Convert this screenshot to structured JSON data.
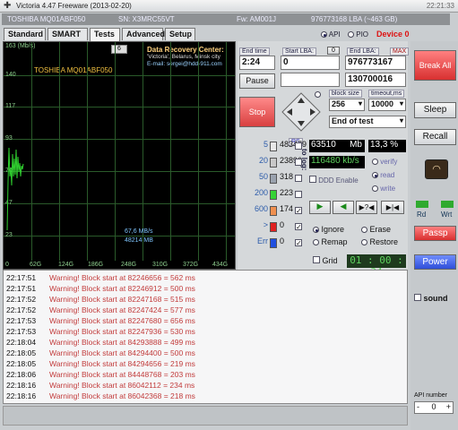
{
  "window": {
    "title": "Victoria 4.47  Freeware (2013-02-20)",
    "clock": "22:21:33"
  },
  "info": {
    "model": "TOSHIBA MQ01ABF050",
    "serial": "SN: X3MRC55VT",
    "firmware": "Fw: AM001J",
    "lba": "976773168 LBA (~463 GB)"
  },
  "tabs": [
    "Standard",
    "SMART",
    "Tests",
    "Advanced",
    "Setup"
  ],
  "api_mode": {
    "api_label": "API",
    "pio_label": "PIO",
    "selected": "API",
    "device": "Device 0"
  },
  "graph": {
    "unit": "163 (Mb/s)",
    "y_ticks": [
      "140",
      "117",
      "93",
      "70",
      "47",
      "23"
    ],
    "x_ticks": [
      "0",
      "62G",
      "124G",
      "186G",
      "248G",
      "310G",
      "372G",
      "434G"
    ],
    "model": "TOSHIBA MQ01ABF050",
    "step_value": "6",
    "speed": "67,6 MB/s",
    "processed": "48214 MB",
    "center_title": "Data Recovery Center:",
    "center_city": "'Victoria', Belarus, Minsk city",
    "center_email": "E-mail: sergei@hdd-911.com"
  },
  "controls": {
    "end_time_label": "End time",
    "end_time": "2:24",
    "start_lba_label": "Start LBA:",
    "start_lba": "0",
    "start_lba_btn": "0",
    "end_lba_label": "End LBA:",
    "end_lba_max": "MAX",
    "end_lba": "976773167",
    "cur_lba": "130700016",
    "pause_btn": "Pause",
    "stop_btn": "Stop",
    "block_size_label": "block size",
    "block_size": "256",
    "timeout_label": "timeout,ms",
    "timeout": "10000",
    "end_mode": "End of test"
  },
  "blocks": [
    {
      "cnt": "5",
      "val": "483479",
      "color": "#e8e8e8",
      "checked": false
    },
    {
      "cnt": "20",
      "val": "23896",
      "color": "#c8c8c8",
      "checked": false
    },
    {
      "cnt": "50",
      "val": "318",
      "color": "#9aa2ae",
      "checked": false
    },
    {
      "cnt": "200",
      "val": "223",
      "color": "#36d236",
      "checked": false
    },
    {
      "cnt": "600",
      "val": "174",
      "color": "#f09050",
      "checked": true
    },
    {
      "cnt": ">",
      "val": "0",
      "color": "#e02020",
      "checked": true
    },
    {
      "cnt": "Err",
      "val": "0",
      "color": "#2050e0",
      "checked": true
    }
  ],
  "to_log": "to log:",
  "rs": "RS",
  "stats": {
    "mb_done": "63510",
    "mb_unit": "Mb",
    "percent": "13,3",
    "pct_unit": "%",
    "speed": "116480",
    "speed_unit": "kb/s"
  },
  "verify": {
    "options": [
      "verify",
      "read",
      "write"
    ],
    "selected": "read"
  },
  "ddd": "DDD Enable",
  "errors": {
    "options": [
      "Ignore",
      "Erase",
      "Remap",
      "Restore"
    ],
    "selected": "Ignore"
  },
  "grid_label": "Grid",
  "timer": "01 : 00 : 34",
  "sidebar": {
    "break": "Break All",
    "sleep": "Sleep",
    "recall": "Recall",
    "rd": "Rd",
    "wrt": "Wrt",
    "passp": "Passp",
    "power": "Power",
    "sound": "sound",
    "api_number": "API number",
    "api_value": "0"
  },
  "log": [
    {
      "t": "22:17:51",
      "m": "Warning! Block start at 82246656 = 562 ms"
    },
    {
      "t": "22:17:51",
      "m": "Warning! Block start at 82246912 = 500 ms"
    },
    {
      "t": "22:17:52",
      "m": "Warning! Block start at 82247168 = 515 ms"
    },
    {
      "t": "22:17:52",
      "m": "Warning! Block start at 82247424 = 577 ms"
    },
    {
      "t": "22:17:53",
      "m": "Warning! Block start at 82247680 = 656 ms"
    },
    {
      "t": "22:17:53",
      "m": "Warning! Block start at 82247936 = 530 ms"
    },
    {
      "t": "22:18:04",
      "m": "Warning! Block start at 84293888 = 499 ms"
    },
    {
      "t": "22:18:05",
      "m": "Warning! Block start at 84294400 = 500 ms"
    },
    {
      "t": "22:18:05",
      "m": "Warning! Block start at 84294656 = 219 ms"
    },
    {
      "t": "22:18:06",
      "m": "Warning! Block start at 84448768 = 203 ms"
    },
    {
      "t": "22:18:16",
      "m": "Warning! Block start at 86042112 = 234 ms"
    },
    {
      "t": "22:18:16",
      "m": "Warning! Block start at 86042368 = 218 ms"
    }
  ]
}
